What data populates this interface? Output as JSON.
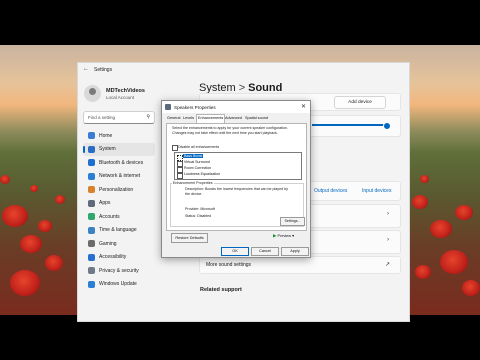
{
  "settings": {
    "window_title": "Settings",
    "user": {
      "name": "MDTechVideos",
      "account_type": "Local Account"
    },
    "search": {
      "placeholder": "Find a setting"
    },
    "nav": [
      {
        "label": "Home",
        "icon": "home-icon",
        "color": "#3a7bd5"
      },
      {
        "label": "System",
        "icon": "monitor-icon",
        "color": "#2b6cc4",
        "active": true
      },
      {
        "label": "Bluetooth & devices",
        "icon": "bluetooth-icon",
        "color": "#1f6fd1"
      },
      {
        "label": "Network & internet",
        "icon": "wifi-icon",
        "color": "#2a7fd4"
      },
      {
        "label": "Personalization",
        "icon": "brush-icon",
        "color": "#d9822b"
      },
      {
        "label": "Apps",
        "icon": "apps-icon",
        "color": "#5f6b7a"
      },
      {
        "label": "Accounts",
        "icon": "person-icon",
        "color": "#2ea86b"
      },
      {
        "label": "Time & language",
        "icon": "clock-icon",
        "color": "#3b82c4"
      },
      {
        "label": "Gaming",
        "icon": "gamepad-icon",
        "color": "#6b6b6b"
      },
      {
        "label": "Accessibility",
        "icon": "accessibility-icon",
        "color": "#2a6fcf"
      },
      {
        "label": "Privacy & security",
        "icon": "shield-icon",
        "color": "#707a88"
      },
      {
        "label": "Windows Update",
        "icon": "update-icon",
        "color": "#2a7fd4"
      }
    ],
    "breadcrumb": {
      "parent": "System",
      "separator": ">",
      "current": "Sound"
    },
    "add_device_label": "Add device",
    "output_devices_label": "Output devices",
    "input_devices_label": "Input devices",
    "more_sound_settings_label": "More sound settings",
    "related_support_label": "Related support"
  },
  "dialog": {
    "title": "Speakers Properties",
    "tabs": [
      "General",
      "Levels",
      "Enhancements",
      "Advanced",
      "Spatial sound"
    ],
    "active_tab": "Enhancements",
    "instructions": "Select the enhancements to apply for your current speaker configuration. Changes may not take effect until the next time you start playback.",
    "disable_all_label": "Disable all enhancements",
    "enhancements": [
      {
        "label": "Bass Boost",
        "selected": true
      },
      {
        "label": "Virtual Surround"
      },
      {
        "label": "Room Correction"
      },
      {
        "label": "Loudness Equalization"
      }
    ],
    "properties_heading": "Enhancement Properties",
    "description": "Description: Boosts the lowest frequencies that can be played by the device.",
    "provider": "Provider: Microsoft",
    "status": "Status: Disabled",
    "settings_button": "Settings...",
    "restore_defaults": "Restore Defaults",
    "preview_label": "Preview",
    "ok_label": "OK",
    "cancel_label": "Cancel",
    "apply_label": "Apply"
  }
}
